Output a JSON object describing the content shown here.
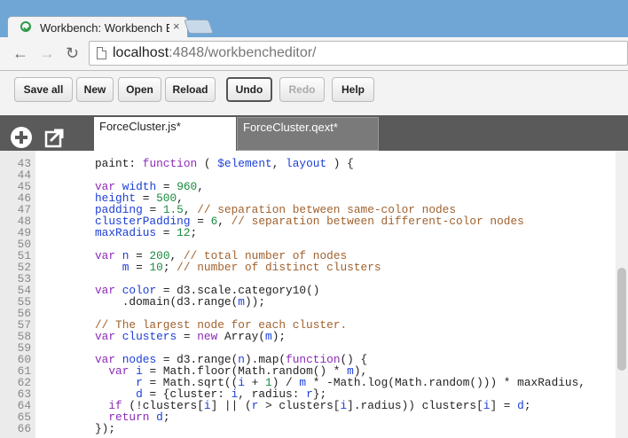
{
  "browser": {
    "tab_title": "Workbench: Workbench E",
    "close_glyph": "×",
    "back_glyph": "←",
    "forward_glyph": "→",
    "reload_glyph": "↻",
    "url_host": "localhost",
    "url_rest": ":4848/workbencheditor/"
  },
  "toolbar": {
    "save_all": "Save all",
    "new": "New",
    "open": "Open",
    "reload": "Reload",
    "undo": "Undo",
    "redo": "Redo",
    "help": "Help"
  },
  "editor_tabs": [
    {
      "label": "ForceCluster.js*",
      "active": true
    },
    {
      "label": "ForceCluster.qext*",
      "active": false
    }
  ],
  "code_lines": [
    {
      "n": "43",
      "html": "paint: <span class=\"kw\">function</span> ( <span class=\"var\">$element</span>, <span class=\"var\">layout</span> ) {"
    },
    {
      "n": "44",
      "html": ""
    },
    {
      "n": "45",
      "html": "<span class=\"kw\">var</span> <span class=\"var\">width</span> = <span class=\"num\">960</span>,"
    },
    {
      "n": "46",
      "html": "<span class=\"var\">height</span> = <span class=\"num\">500</span>,"
    },
    {
      "n": "47",
      "html": "<span class=\"var\">padding</span> = <span class=\"num\">1.5</span>, <span class=\"cm\">// separation between same-color nodes</span>"
    },
    {
      "n": "48",
      "html": "<span class=\"var\">clusterPadding</span> = <span class=\"num\">6</span>, <span class=\"cm\">// separation between different-color nodes</span>"
    },
    {
      "n": "49",
      "html": "<span class=\"var\">maxRadius</span> = <span class=\"num\">12</span>;"
    },
    {
      "n": "50",
      "html": ""
    },
    {
      "n": "51",
      "html": "<span class=\"kw\">var</span> <span class=\"var\">n</span> = <span class=\"num\">200</span>, <span class=\"cm\">// total number of nodes</span>"
    },
    {
      "n": "52",
      "html": "    <span class=\"var\">m</span> = <span class=\"num\">10</span>; <span class=\"cm\">// number of distinct clusters</span>"
    },
    {
      "n": "53",
      "html": ""
    },
    {
      "n": "54",
      "html": "<span class=\"kw\">var</span> <span class=\"var\">color</span> = d3.scale.category10()"
    },
    {
      "n": "55",
      "html": "    .domain(d3.range(<span class=\"var\">m</span>));"
    },
    {
      "n": "56",
      "html": ""
    },
    {
      "n": "57",
      "html": "<span class=\"cm\">// The largest node for each cluster.</span>"
    },
    {
      "n": "58",
      "html": "<span class=\"kw\">var</span> <span class=\"var\">clusters</span> = <span class=\"kw\">new</span> Array(<span class=\"var\">m</span>);"
    },
    {
      "n": "59",
      "html": ""
    },
    {
      "n": "60",
      "html": "<span class=\"kw\">var</span> <span class=\"var\">nodes</span> = d3.range(<span class=\"var\">n</span>).map(<span class=\"kw\">function</span>() {"
    },
    {
      "n": "61",
      "html": "  <span class=\"kw\">var</span> <span class=\"var\">i</span> = Math.floor(Math.random() * <span class=\"var\">m</span>),"
    },
    {
      "n": "62",
      "html": "      <span class=\"var\">r</span> = Math.sqrt((<span class=\"var\">i</span> + <span class=\"num\">1</span>) / <span class=\"var\">m</span> * -Math.log(Math.random())) * maxRadius,"
    },
    {
      "n": "63",
      "html": "      <span class=\"var\">d</span> = {cluster: <span class=\"var\">i</span>, radius: <span class=\"var\">r</span>};"
    },
    {
      "n": "64",
      "html": "  <span class=\"kw\">if</span> (!clusters[<span class=\"var\">i</span>] || (<span class=\"var\">r</span> &gt; clusters[<span class=\"var\">i</span>].radius)) clusters[<span class=\"var\">i</span>] = <span class=\"var\">d</span>;"
    },
    {
      "n": "65",
      "html": "  <span class=\"kw\">return</span> <span class=\"var\">d</span>;"
    },
    {
      "n": "66",
      "html": "});"
    }
  ]
}
